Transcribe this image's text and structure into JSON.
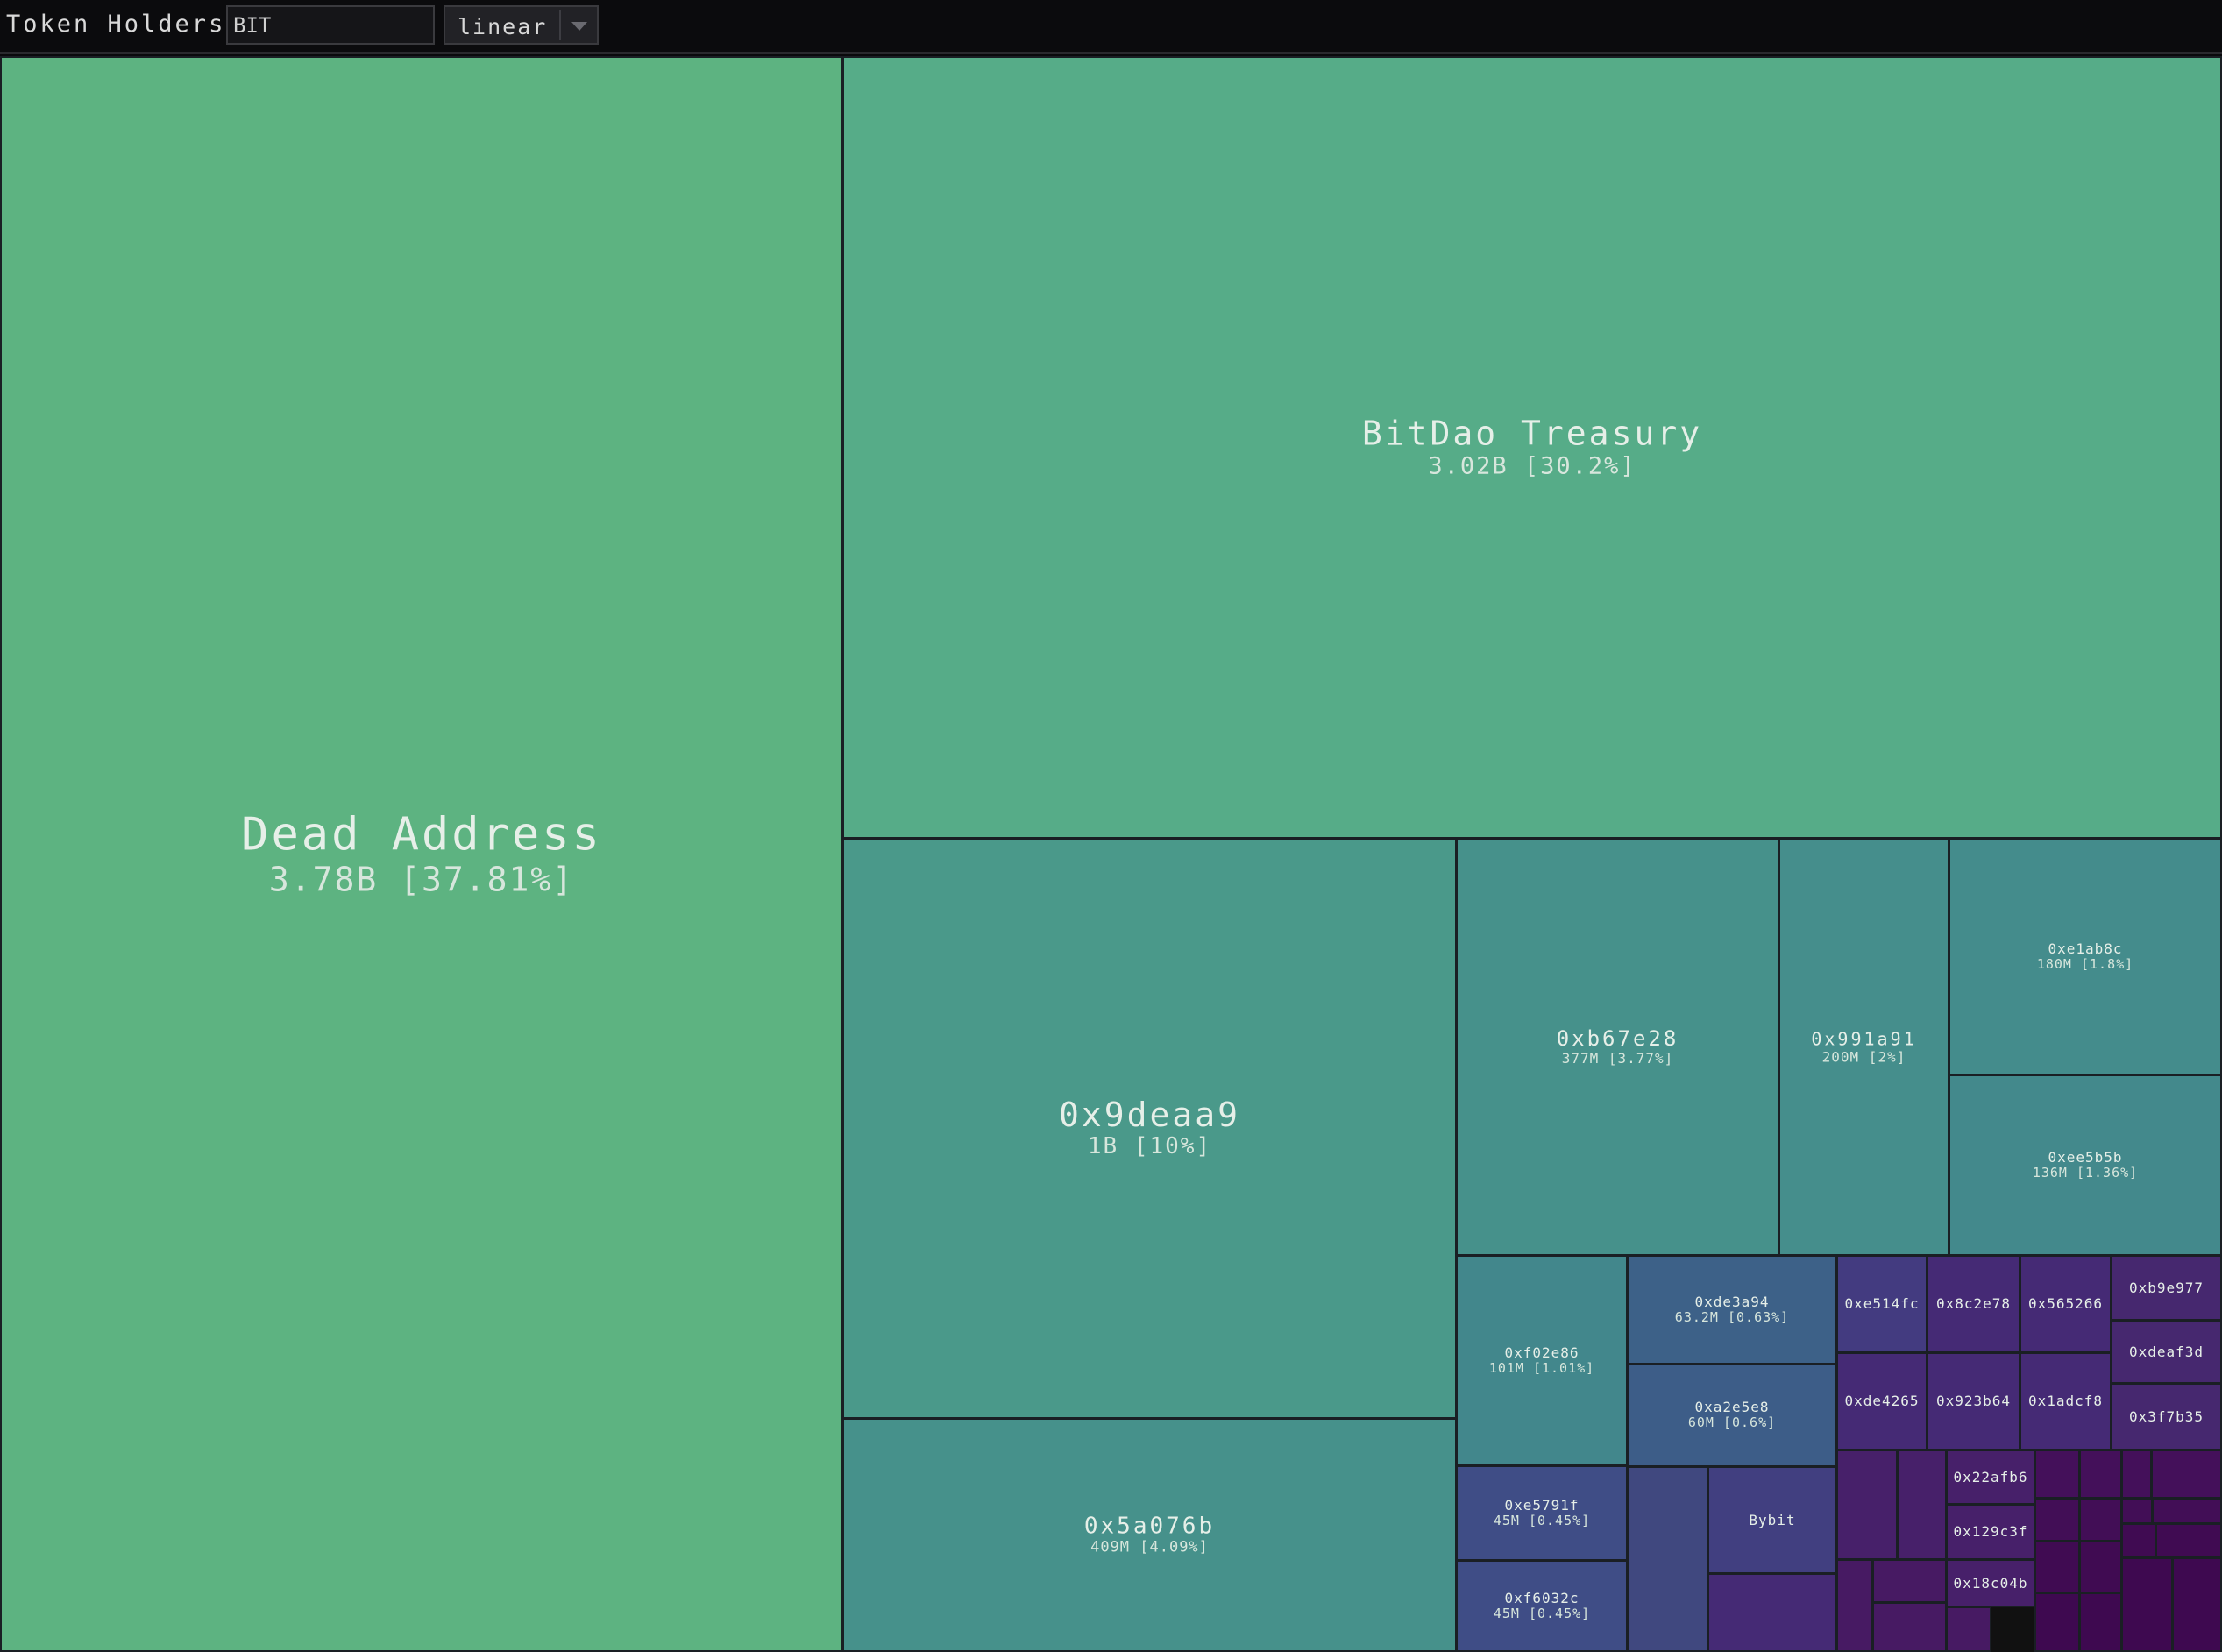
{
  "toolbar": {
    "title": "Token Holders",
    "token_value": "BIT",
    "scale_value": "linear"
  },
  "colors": {
    "background": "#0a0a0c",
    "scale": "viridis"
  },
  "chart_data": {
    "type": "treemap",
    "title": "",
    "holders": [
      {
        "name": "Dead Address",
        "amount_label": "3.78B [37.81%]",
        "value": 3780000000,
        "percent": 37.81,
        "color": "#5db381"
      },
      {
        "name": "BitDao Treasury",
        "amount_label": "3.02B [30.2%]",
        "value": 3020000000,
        "percent": 30.2,
        "color": "#56ac88"
      },
      {
        "name": "0x9deaa9",
        "amount_label": "1B [10%]",
        "value": 1000000000,
        "percent": 10,
        "color": "#4a998a"
      },
      {
        "name": "0x5a076b",
        "amount_label": "409M [4.09%]",
        "value": 409000000,
        "percent": 4.09,
        "color": "#46918b"
      },
      {
        "name": "0xb67e28",
        "amount_label": "377M [3.77%]",
        "value": 377000000,
        "percent": 3.77,
        "color": "#46918b"
      },
      {
        "name": "0x991a91",
        "amount_label": "200M [2%]",
        "value": 200000000,
        "percent": 2,
        "color": "#458e8c"
      },
      {
        "name": "0xe1ab8c",
        "amount_label": "180M [1.8%]",
        "value": 180000000,
        "percent": 1.8,
        "color": "#448c8c"
      },
      {
        "name": "0xee5b5b",
        "amount_label": "136M [1.36%]",
        "value": 136000000,
        "percent": 1.36,
        "color": "#43898c"
      },
      {
        "name": "0xf02e86",
        "amount_label": "101M [1.01%]",
        "value": 101000000,
        "percent": 1.01,
        "color": "#42878c"
      },
      {
        "name": "0xde3a94",
        "amount_label": "63.2M [0.63%]",
        "value": 63200000,
        "percent": 0.63,
        "color": "#3d6188"
      },
      {
        "name": "0xa2e5e8",
        "amount_label": "60M [0.6%]",
        "value": 60000000,
        "percent": 0.6,
        "color": "#3d5d88"
      },
      {
        "name": "0xe5791f",
        "amount_label": "45M [0.45%]",
        "value": 45000000,
        "percent": 0.45,
        "color": "#3f4d86"
      },
      {
        "name": "0xf6032c",
        "amount_label": "45M [0.45%]",
        "value": 45000000,
        "percent": 0.45,
        "color": "#3f4d86"
      },
      {
        "name": "",
        "amount_label": "",
        "value": null,
        "percent": null,
        "color": "#40487f"
      },
      {
        "name": "Bybit",
        "amount_label": "",
        "value": null,
        "percent": null,
        "color": "#413f80"
      },
      {
        "name": "0xe514fc",
        "amount_label": "",
        "value": null,
        "percent": null,
        "color": "#433b80"
      },
      {
        "name": "",
        "amount_label": "",
        "value": null,
        "percent": null,
        "color": "#452a75"
      },
      {
        "name": "0x8c2e78",
        "amount_label": "",
        "value": null,
        "percent": null,
        "color": "#452a75"
      },
      {
        "name": "0x565266",
        "amount_label": "",
        "value": null,
        "percent": null,
        "color": "#452a75"
      },
      {
        "name": "0xb9e977",
        "amount_label": "",
        "value": null,
        "percent": null,
        "color": "#46286f"
      },
      {
        "name": "0xdeaf3d",
        "amount_label": "",
        "value": null,
        "percent": null,
        "color": "#46286f"
      },
      {
        "name": "0xde4265",
        "amount_label": "",
        "value": null,
        "percent": null,
        "color": "#452a75"
      },
      {
        "name": "0x923b64",
        "amount_label": "",
        "value": null,
        "percent": null,
        "color": "#452a75"
      },
      {
        "name": "0x1adcf8",
        "amount_label": "",
        "value": null,
        "percent": null,
        "color": "#452a75"
      },
      {
        "name": "0x3f7b35",
        "amount_label": "",
        "value": null,
        "percent": null,
        "color": "#46286f"
      },
      {
        "name": "",
        "amount_label": "",
        "value": null,
        "percent": null,
        "color": "#47206a"
      },
      {
        "name": "",
        "amount_label": "",
        "value": null,
        "percent": null,
        "color": "#47206a"
      },
      {
        "name": "0x22afb6",
        "amount_label": "",
        "value": null,
        "percent": null,
        "color": "#47206a"
      },
      {
        "name": "0x129c3f",
        "amount_label": "",
        "value": null,
        "percent": null,
        "color": "#47206a"
      },
      {
        "name": "",
        "amount_label": "",
        "value": null,
        "percent": null,
        "color": "#471a63"
      },
      {
        "name": "",
        "amount_label": "",
        "value": null,
        "percent": null,
        "color": "#471a63"
      },
      {
        "name": "0x18c04b",
        "amount_label": "",
        "value": null,
        "percent": null,
        "color": "#47206a"
      },
      {
        "name": "",
        "amount_label": "",
        "value": null,
        "percent": null,
        "color": "#471a63"
      },
      {
        "name": "",
        "amount_label": "",
        "value": null,
        "percent": null,
        "color": "#471a63"
      },
      {
        "name": "",
        "amount_label": "",
        "value": null,
        "percent": null,
        "color": "#44105a"
      },
      {
        "name": "",
        "amount_label": "",
        "value": null,
        "percent": null,
        "color": "#44105a"
      },
      {
        "name": "",
        "amount_label": "",
        "value": null,
        "percent": null,
        "color": "#44105a"
      },
      {
        "name": "",
        "amount_label": "",
        "value": null,
        "percent": null,
        "color": "#44105a"
      },
      {
        "name": "",
        "amount_label": "",
        "value": null,
        "percent": null,
        "color": "#420e56"
      },
      {
        "name": "",
        "amount_label": "",
        "value": null,
        "percent": null,
        "color": "#420e56"
      },
      {
        "name": "",
        "amount_label": "",
        "value": null,
        "percent": null,
        "color": "#420e56"
      },
      {
        "name": "",
        "amount_label": "",
        "value": null,
        "percent": null,
        "color": "#420e56"
      },
      {
        "name": "",
        "amount_label": "",
        "value": null,
        "percent": null,
        "color": "#400b52"
      },
      {
        "name": "",
        "amount_label": "",
        "value": null,
        "percent": null,
        "color": "#400b52"
      },
      {
        "name": "",
        "amount_label": "",
        "value": null,
        "percent": null,
        "color": "#400b52"
      },
      {
        "name": "",
        "amount_label": "",
        "value": null,
        "percent": null,
        "color": "#400b52"
      },
      {
        "name": "",
        "amount_label": "",
        "value": null,
        "percent": null,
        "color": "#3e0950"
      },
      {
        "name": "",
        "amount_label": "",
        "value": null,
        "percent": null,
        "color": "#3e0950"
      },
      {
        "name": "",
        "amount_label": "",
        "value": null,
        "percent": null,
        "color": "#3e0950"
      },
      {
        "name": "",
        "amount_label": "",
        "value": null,
        "percent": null,
        "color": "#3e0950"
      }
    ]
  }
}
